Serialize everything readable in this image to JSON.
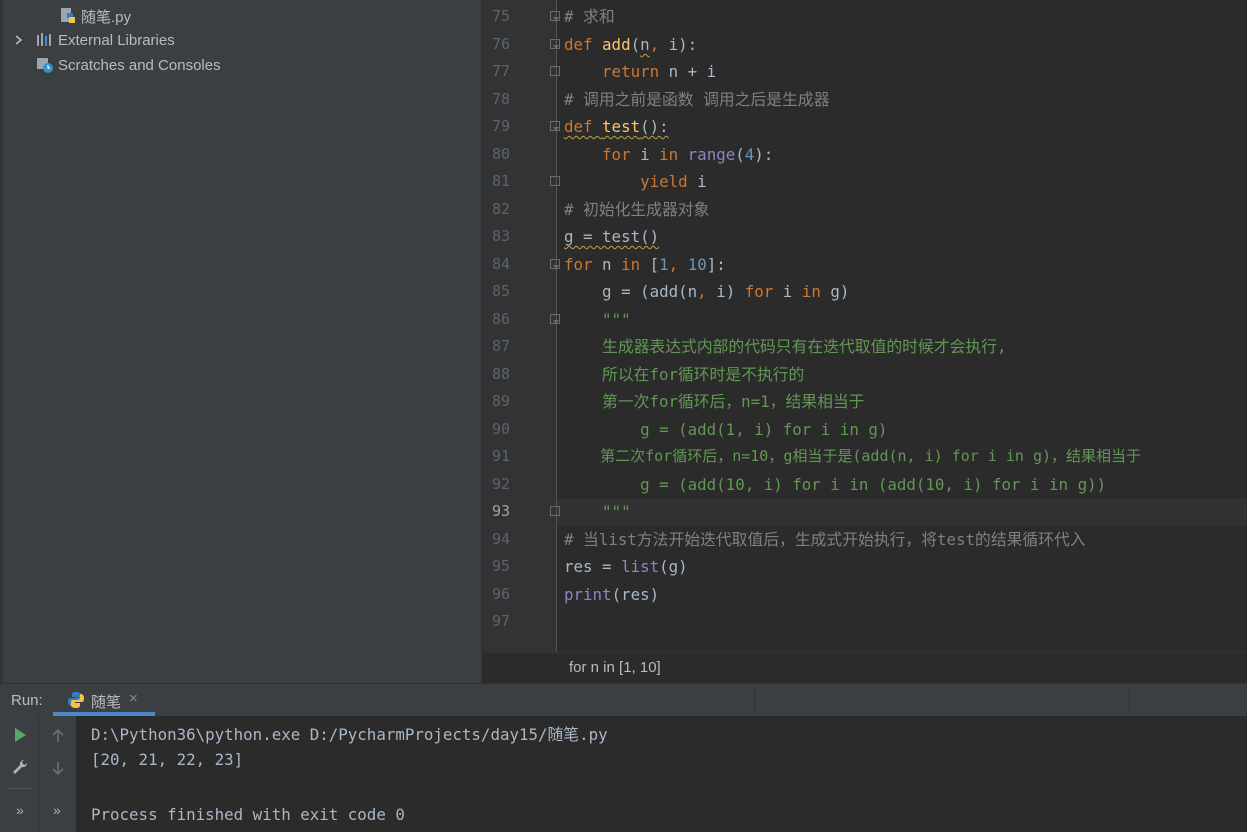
{
  "project_tree": {
    "file_item": "随笔.py",
    "external_libraries": "External Libraries",
    "scratches": "Scratches and Consoles"
  },
  "editor": {
    "line_numbers": [
      "75",
      "76",
      "77",
      "78",
      "79",
      "80",
      "81",
      "82",
      "83",
      "84",
      "85",
      "86",
      "87",
      "88",
      "89",
      "90",
      "91",
      "92",
      "93",
      "94",
      "95",
      "96",
      "97"
    ],
    "current_line": "93",
    "lines": {
      "l75": "# 求和",
      "l78": "# 调用之前是函数 调用之后是生成器",
      "l82": "# 初始化生成器对象",
      "l86": "    \"\"\"",
      "l87": "    生成器表达式内部的代码只有在迭代取值的时候才会执行,",
      "l88": "    所以在for循环时是不执行的",
      "l89": "    第一次for循环后，n=1，结果相当于",
      "l90": "        g = (add(1, i) for i in g)",
      "l91": "    第二次for循环后，n=10，g相当于是(add(n, i) for i in g)，结果相当于",
      "l92": "        g = (add(10, i) for i in (add(10, i) for i in g))",
      "l93": "    \"\"\"",
      "l94": "# 当list方法开始迭代取值后，生成式开始执行，将test的结果循环代入"
    },
    "breadcrumb": "for n in [1, 10]"
  },
  "run_panel": {
    "label": "Run:",
    "tab_label": "随笔",
    "tab_close": "×",
    "output": [
      "D:\\Python36\\python.exe D:/PycharmProjects/day15/随笔.py",
      "[20, 21, 22, 23]",
      "",
      "Process finished with exit code 0"
    ],
    "side_more_1": "»",
    "side_more_2": "»"
  },
  "colors": {
    "keyword": "#cc7832",
    "function": "#ffc66d",
    "number": "#6897bb",
    "comment": "#808080",
    "docstring": "#629755",
    "builtin": "#8888c6",
    "accent": "#4a88c7",
    "run_green": "#59a869"
  },
  "icons": [
    "python-file-icon",
    "chevron-right-icon",
    "library-icon",
    "scratches-icon",
    "python-icon",
    "run-icon",
    "wrench-icon",
    "up-arrow-icon",
    "down-arrow-icon"
  ]
}
